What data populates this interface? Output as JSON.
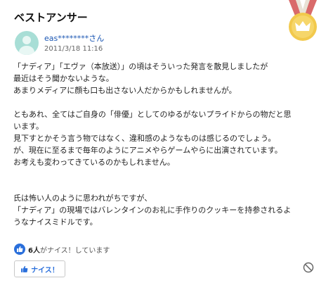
{
  "header": {
    "title": "ベストアンサー"
  },
  "user": {
    "name": "eas********さん",
    "date": "2011/3/18 11:16"
  },
  "answer": {
    "lines": [
      "「ナディア」「エヴァ（本放送）」の頃はそういった発言を散見しましたが",
      "最近はそう聞かないような。",
      "あまりメディアに顔も口も出さない人だからかもしれませんが。",
      "",
      "ともあれ、全てはご自身の「俳優」としてのゆるがないプライドからの物だと思",
      "います。",
      "見下すとかそう言う物ではなく、違和感のようなものは感じるのでしょう。",
      "が、現在に至るまで毎年のようにアニメやらゲームやらに出演されています。",
      "お考えも変わってきているのかもしれません。",
      "",
      "",
      "氏は怖い人のように思われがちですが、",
      "「ナディア」の現場ではバレンタインのお礼に手作りのクッキーを持参されるよ",
      "うなナイスミドルです。"
    ]
  },
  "reaction": {
    "count": "6人",
    "suffix": "がナイス！しています"
  },
  "actions": {
    "nice_label": "ナイス！"
  },
  "icons": {
    "medal": "crown-medal-icon",
    "like": "thumbs-up-icon",
    "report": "prohibited-icon"
  },
  "colors": {
    "link": "#1a56b3",
    "accent": "#2a6fdb",
    "medal_gold": "#f2c94c",
    "ribbon": "#d96a6a"
  }
}
